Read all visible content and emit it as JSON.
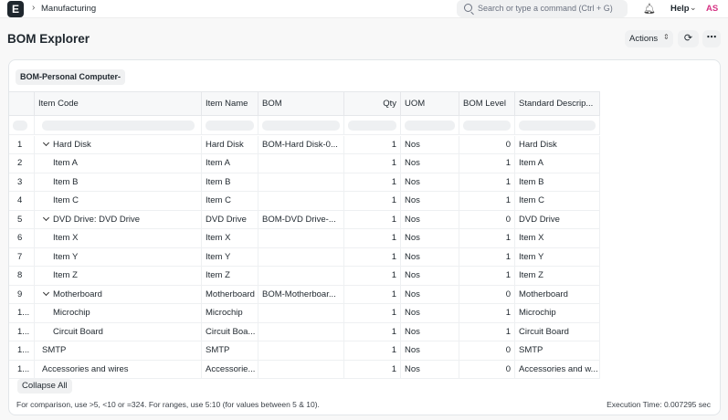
{
  "navbar": {
    "logo": "E",
    "breadcrumb": "Manufacturing",
    "search_placeholder": "Search or type a command (Ctrl + G)",
    "help_label": "Help",
    "avatar_initials": "AS"
  },
  "page": {
    "title": "BOM Explorer",
    "actions_label": "Actions"
  },
  "filter": {
    "bom_value": "BOM-Personal Computer-"
  },
  "table": {
    "columns": [
      "Item Code",
      "Item Name",
      "BOM",
      "Qty",
      "UOM",
      "BOM Level",
      "Standard Descrip..."
    ],
    "rows": [
      {
        "idx": "1",
        "expander": true,
        "indent": false,
        "code": "Hard Disk",
        "name": "Hard Disk",
        "bom": "BOM-Hard Disk-0...",
        "qty": "1",
        "uom": "Nos",
        "level": "0",
        "desc": "Hard Disk"
      },
      {
        "idx": "2",
        "expander": false,
        "indent": true,
        "code": "Item A",
        "name": "Item A",
        "bom": "",
        "qty": "1",
        "uom": "Nos",
        "level": "1",
        "desc": "Item A"
      },
      {
        "idx": "3",
        "expander": false,
        "indent": true,
        "code": "Item B",
        "name": "Item B",
        "bom": "",
        "qty": "1",
        "uom": "Nos",
        "level": "1",
        "desc": "Item B"
      },
      {
        "idx": "4",
        "expander": false,
        "indent": true,
        "code": "Item C",
        "name": "Item C",
        "bom": "",
        "qty": "1",
        "uom": "Nos",
        "level": "1",
        "desc": "Item C"
      },
      {
        "idx": "5",
        "expander": true,
        "indent": false,
        "code": "DVD Drive: DVD Drive",
        "name": "DVD Drive",
        "bom": "BOM-DVD Drive-...",
        "qty": "1",
        "uom": "Nos",
        "level": "0",
        "desc": "DVD Drive"
      },
      {
        "idx": "6",
        "expander": false,
        "indent": true,
        "code": "Item X",
        "name": "Item X",
        "bom": "",
        "qty": "1",
        "uom": "Nos",
        "level": "1",
        "desc": "Item X"
      },
      {
        "idx": "7",
        "expander": false,
        "indent": true,
        "code": "Item Y",
        "name": "Item Y",
        "bom": "",
        "qty": "1",
        "uom": "Nos",
        "level": "1",
        "desc": "Item Y"
      },
      {
        "idx": "8",
        "expander": false,
        "indent": true,
        "code": "Item Z",
        "name": "Item Z",
        "bom": "",
        "qty": "1",
        "uom": "Nos",
        "level": "1",
        "desc": "Item Z"
      },
      {
        "idx": "9",
        "expander": true,
        "indent": false,
        "code": "Motherboard",
        "name": "Motherboard",
        "bom": "BOM-Motherboar...",
        "qty": "1",
        "uom": "Nos",
        "level": "0",
        "desc": "Motherboard"
      },
      {
        "idx": "1...",
        "expander": false,
        "indent": true,
        "code": "Microchip",
        "name": "Microchip",
        "bom": "",
        "qty": "1",
        "uom": "Nos",
        "level": "1",
        "desc": "Microchip"
      },
      {
        "idx": "1...",
        "expander": false,
        "indent": true,
        "code": "Circuit Board",
        "name": "Circuit Boa...",
        "bom": "",
        "qty": "1",
        "uom": "Nos",
        "level": "1",
        "desc": "Circuit Board"
      },
      {
        "idx": "1...",
        "expander": false,
        "indent": false,
        "code": "SMTP",
        "name": "SMTP",
        "bom": "",
        "qty": "1",
        "uom": "Nos",
        "level": "0",
        "desc": "SMTP"
      },
      {
        "idx": "1...",
        "expander": false,
        "indent": false,
        "code": "Accessories and wires",
        "name": "Accessorie...",
        "bom": "",
        "qty": "1",
        "uom": "Nos",
        "level": "0",
        "desc": "Accessories and w..."
      }
    ]
  },
  "footer": {
    "collapse_label": "Collapse All",
    "hint": "For comparison, use >5, <10 or =324. For ranges, use 5:10 (for values between 5 & 10).",
    "execution_time": "Execution Time: 0.007295 sec"
  }
}
